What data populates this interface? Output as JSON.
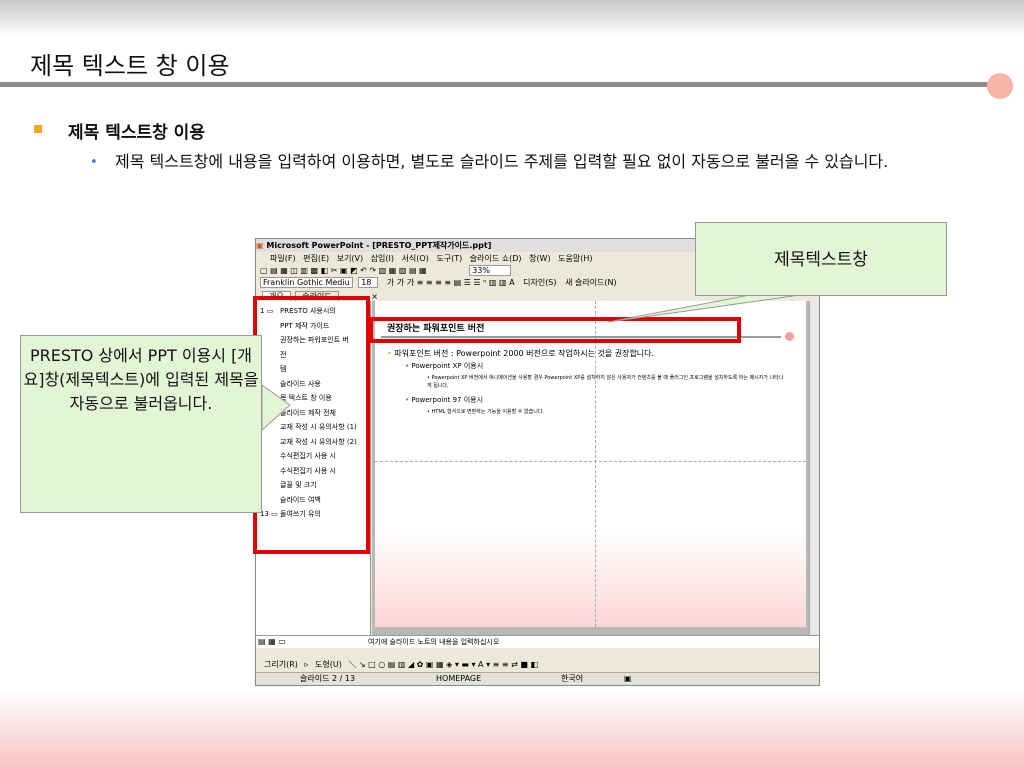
{
  "slide": {
    "title": "제목 텍스트 창 이용",
    "bullet1": "제목 텍스트창 이용",
    "bullet2": "제목 텍스트창에 내용을 입력하여 이용하면, 별도로 슬라이드 주제를 입력할 필요 없이 자동으로 불러올 수 있습니다."
  },
  "window": {
    "title": "Microsoft PowerPoint - [PRESTO_PPT제작가이드.ppt]",
    "menu": [
      "파일(F)",
      "편집(E)",
      "보기(V)",
      "삽입(I)",
      "서식(O)",
      "도구(T)",
      "슬라이드 쇼(D)",
      "창(W)",
      "도움말(H)"
    ],
    "zoom": "33%",
    "font_name": "Franklin Gothic Mediu",
    "font_size": "18",
    "design_label": "디자인(S)",
    "new_slide_label": "새 슬라이드(N)",
    "tabs": [
      "개요",
      "슬라이드"
    ],
    "outline": [
      {
        "num": "1",
        "text": "PRESTO 사용시의"
      },
      {
        "num": "",
        "text": "PPT 제작 가이드"
      },
      {
        "num": "",
        "text": "권장하는 파워포인트 버"
      },
      {
        "num": "",
        "text": "전"
      },
      {
        "num": "",
        "text": "템"
      },
      {
        "num": "",
        "text": "슬라이드 사용"
      },
      {
        "num": "",
        "text": "목 텍스트 창 이용"
      },
      {
        "num": "",
        "text": "슬라이드 제작 전체"
      },
      {
        "num": "",
        "text": "교재 작성 시 유의사항 (1)"
      },
      {
        "num": "",
        "text": "교재 작성 시 유의사항 (2)"
      },
      {
        "num": "",
        "text": "수식편집기 사용 시"
      },
      {
        "num": "",
        "text": "수식편집기 사용 시"
      },
      {
        "num": "",
        "text": "글꼴 및 크기"
      },
      {
        "num": "",
        "text": "슬라이드 여백"
      },
      {
        "num": "13",
        "text": "들여쓰기 유의"
      }
    ],
    "inner_slide": {
      "title": "권장하는 파워포인트 버전",
      "b1": "파워포인트 버전 : Powerpoint 2000 버전으로 작업하시는 것을 권장합니다.",
      "b2": "Powerpoint XP 이용시",
      "b3": "Powerpoint XP 버전에서 애니메이션을 사용할 경우 Powerpoint XP를 설치하지 않은 사용자가 컨텐츠를 볼 때 플러그인 프로그램을 설치하도록 하는 메시지가 나타나게 됩니다.",
      "b4": "Powerpoint 97 이용시",
      "b5": "HTML 형식으로 변환하는 기능을 이용할 수 없습니다."
    },
    "notes_placeholder": "여기에 슬라이드 노트의 내용을 입력하십시오",
    "draw_label": "그리기(R)",
    "autoshape_label": "도형(U)",
    "status": {
      "slide": "슬라이드 2 / 13",
      "design": "HOMEPAGE",
      "lang": "한국어"
    }
  },
  "callouts": {
    "title_pane": "제목텍스트창",
    "presto": "PRESTO 상에서 PPT 이용시 [개요]창(제목텍스트)에 입력된 제목을 자동으로 불러옵니다."
  },
  "colors": {
    "highlight": "#e00000",
    "callout_bg": "#e2f5d4",
    "bullet_orange": "#f5a623"
  }
}
